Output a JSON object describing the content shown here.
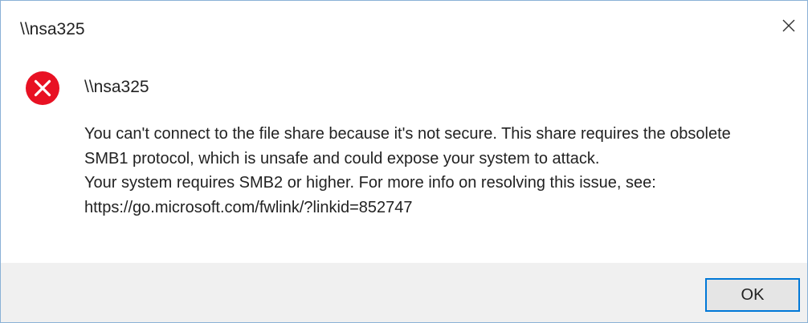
{
  "window": {
    "title": "\\\\nsa325",
    "close_icon": "close-icon"
  },
  "content": {
    "icon": "error-icon",
    "icon_color": "#e81123",
    "header": "\\\\nsa325",
    "message_lines": [
      "You can't connect to the file share because it's not secure. This share requires the obsolete",
      "SMB1 protocol, which is unsafe and could expose your system to attack.",
      "Your system requires SMB2 or higher. For more info on resolving this issue, see:",
      "https://go.microsoft.com/fwlink/?linkid=852747"
    ]
  },
  "footer": {
    "ok_label": "OK",
    "accent_color": "#0078d7"
  }
}
